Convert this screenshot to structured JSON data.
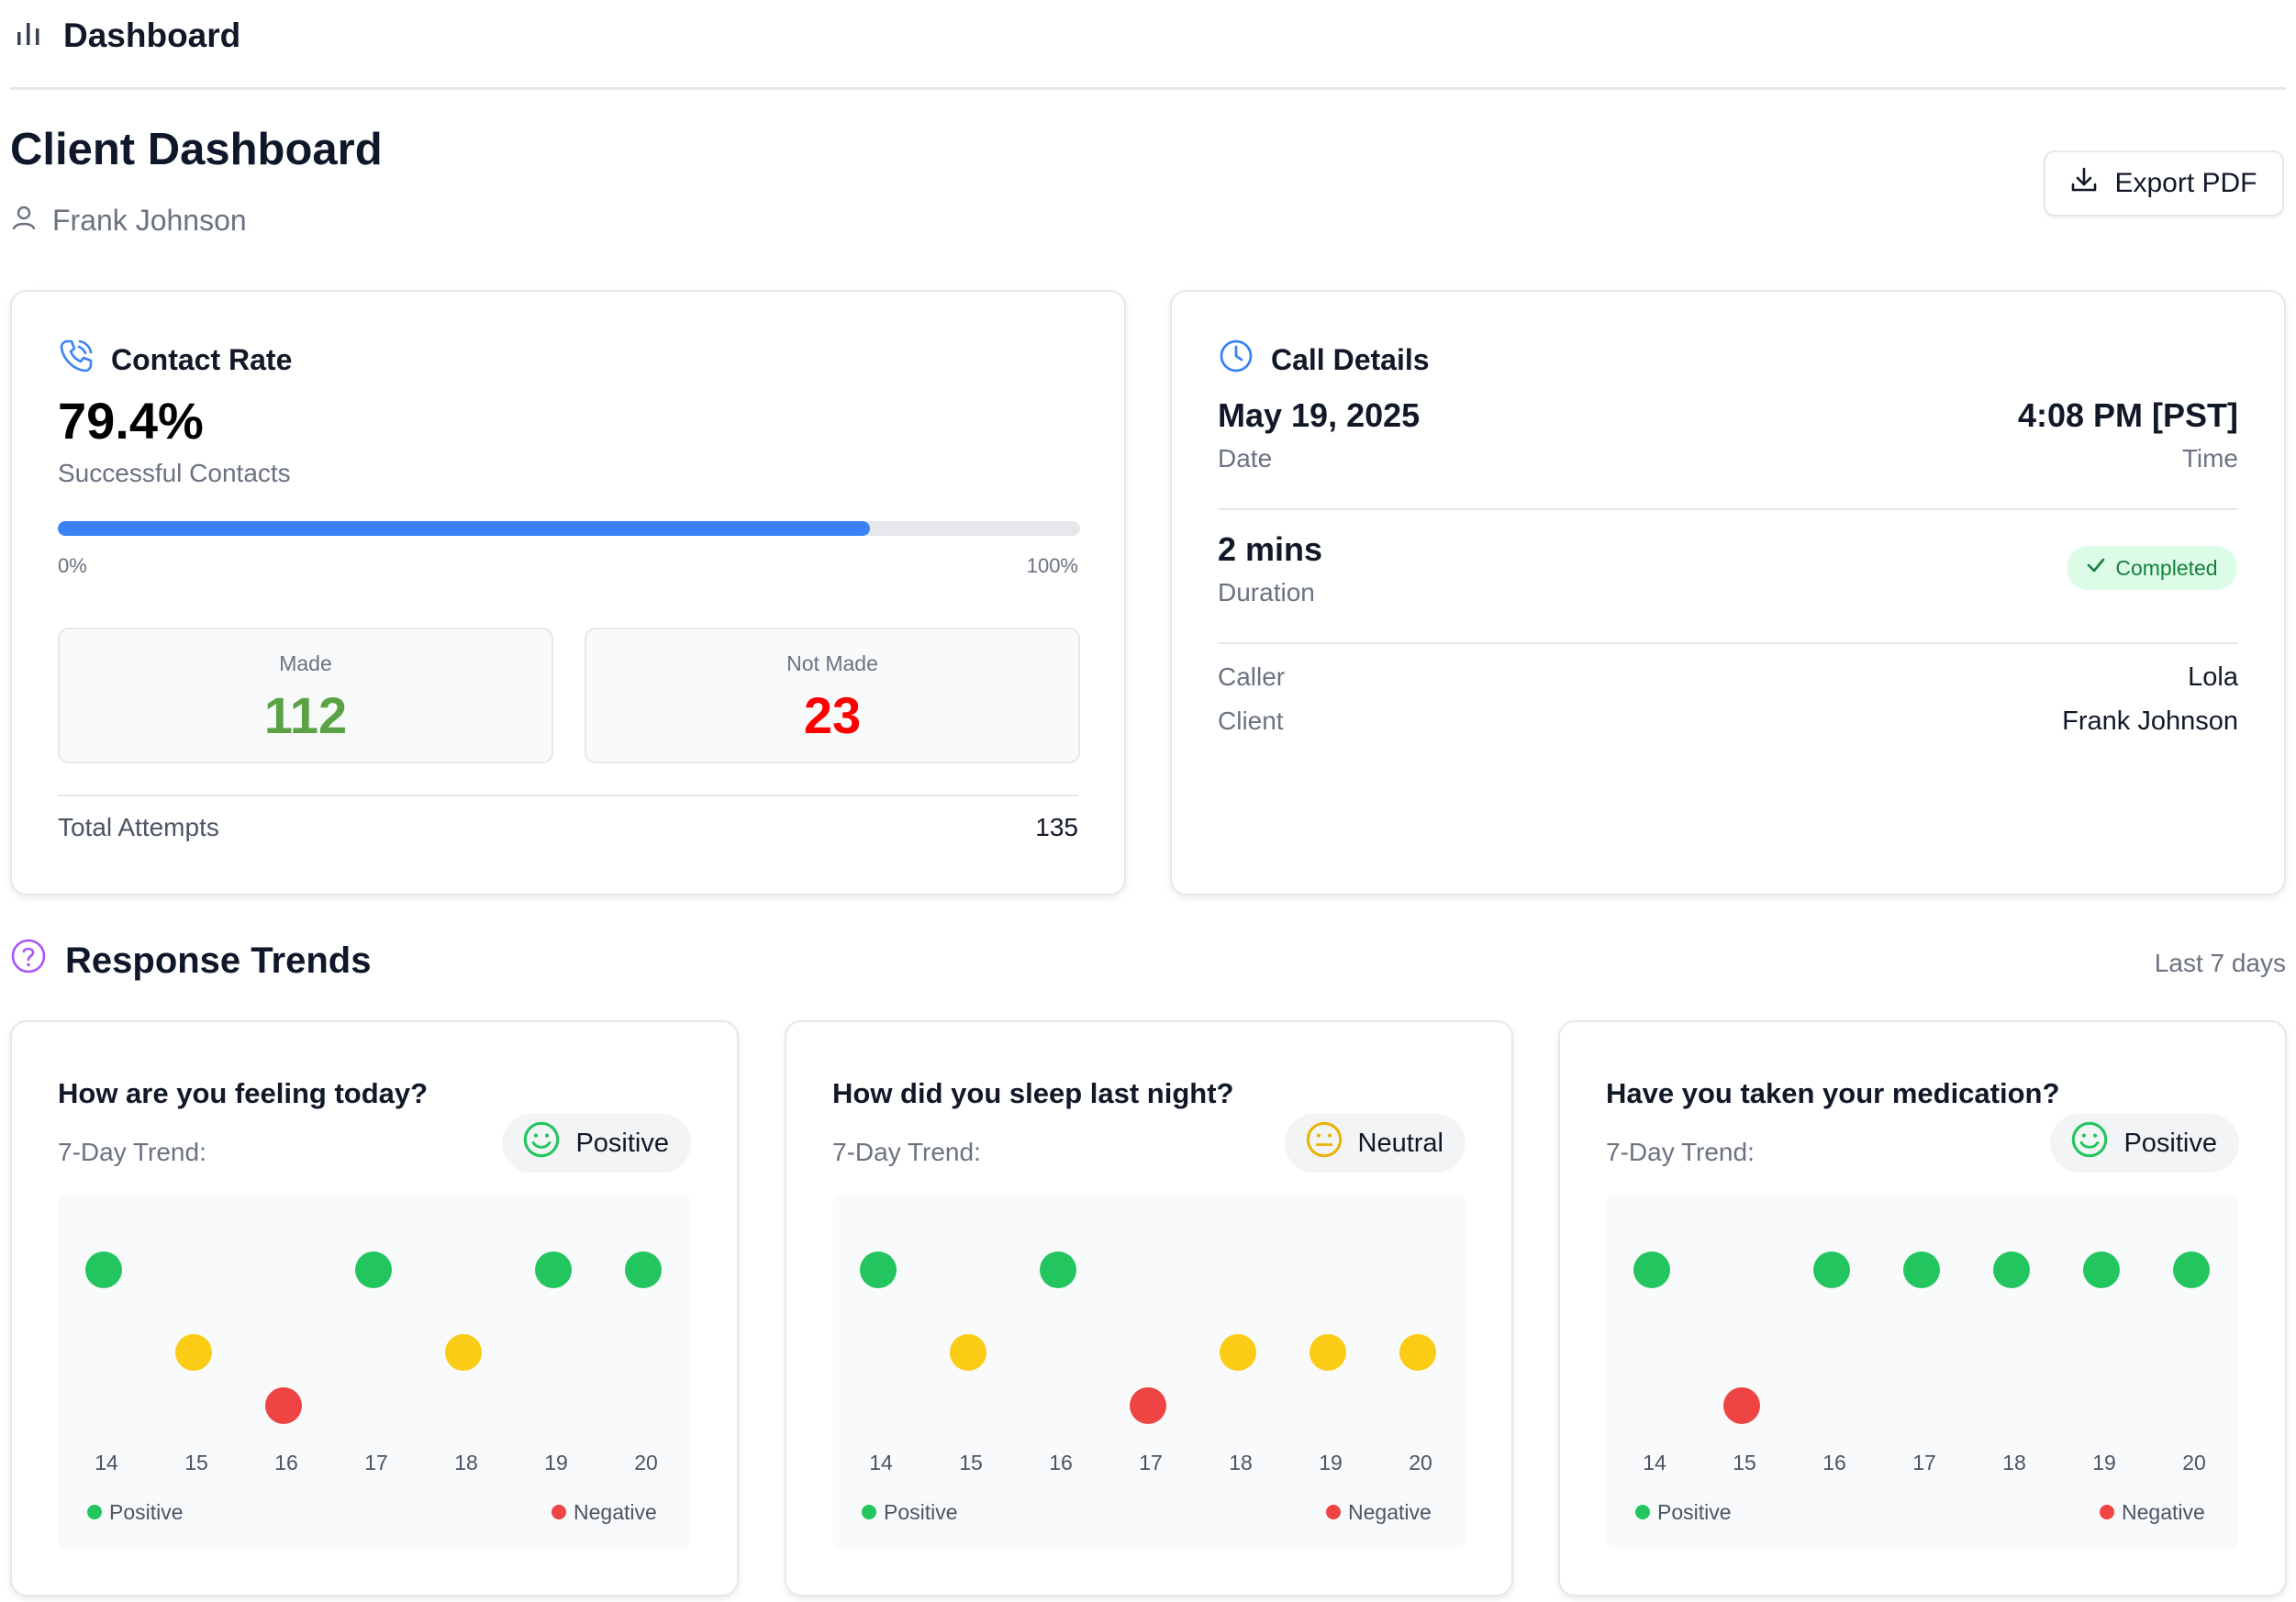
{
  "topbar": {
    "title": "Dashboard",
    "icon": "bar-chart-icon"
  },
  "header": {
    "title": "Client Dashboard",
    "client_name": "Frank Johnson",
    "export_label": "Export PDF"
  },
  "contact_rate": {
    "title": "Contact Rate",
    "rate": "79.4%",
    "rate_fraction": 0.794,
    "rate_label": "Successful Contacts",
    "min_label": "0%",
    "max_label": "100%",
    "made_label": "Made",
    "made_value": "112",
    "not_made_label": "Not Made",
    "not_made_value": "23",
    "total_label": "Total Attempts",
    "total_value": "135"
  },
  "call_details": {
    "title": "Call Details",
    "date": "May 19, 2025",
    "date_label": "Date",
    "time": "4:08 PM [PST]",
    "time_label": "Time",
    "duration": "2 mins",
    "duration_label": "Duration",
    "status": "Completed",
    "caller_label": "Caller",
    "caller_value": "Lola",
    "client_label": "Client",
    "client_value": "Frank Johnson"
  },
  "trends": {
    "title": "Response Trends",
    "range": "Last 7 days",
    "trend_label": "7-Day Trend:",
    "legend_positive": "Positive",
    "legend_negative": "Negative"
  },
  "colors": {
    "positive": "#22c55e",
    "neutral": "#facc15",
    "negative": "#ef4444",
    "accent": "#3b82f6",
    "made": "#5aa345",
    "not_made": "#ff0000"
  },
  "chart_data": [
    {
      "type": "scatter",
      "title": "How are you feeling today?",
      "overall": "Positive",
      "categories": [
        "14",
        "15",
        "16",
        "17",
        "18",
        "19",
        "20"
      ],
      "values": [
        "positive",
        "neutral",
        "negative",
        "positive",
        "neutral",
        "positive",
        "positive"
      ],
      "legend": [
        "Positive",
        "Negative"
      ]
    },
    {
      "type": "scatter",
      "title": "How did you sleep last night?",
      "overall": "Neutral",
      "categories": [
        "14",
        "15",
        "16",
        "17",
        "18",
        "19",
        "20"
      ],
      "values": [
        "positive",
        "neutral",
        "positive",
        "negative",
        "neutral",
        "neutral",
        "neutral"
      ],
      "legend": [
        "Positive",
        "Negative"
      ]
    },
    {
      "type": "scatter",
      "title": "Have you taken your medication?",
      "overall": "Positive",
      "categories": [
        "14",
        "15",
        "16",
        "17",
        "18",
        "19",
        "20"
      ],
      "values": [
        "positive",
        "negative",
        "positive",
        "positive",
        "positive",
        "positive",
        "positive"
      ],
      "legend": [
        "Positive",
        "Negative"
      ]
    }
  ]
}
